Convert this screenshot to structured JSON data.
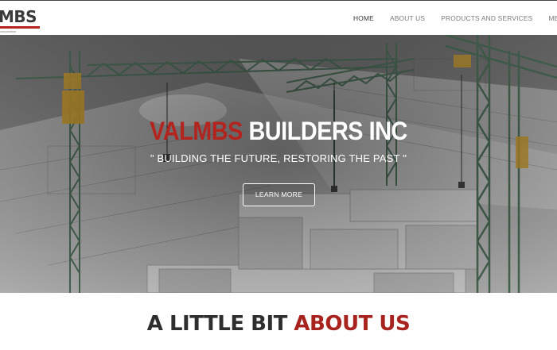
{
  "header": {
    "logo_text": "MBS",
    "logo_sub": "corporation"
  },
  "nav": {
    "items": [
      {
        "label": "HOME",
        "active": true
      },
      {
        "label": "ABOUT US",
        "active": false
      },
      {
        "label": "PRODUCTS AND SERVICES",
        "active": false
      },
      {
        "label": "MEET TH",
        "active": false
      }
    ]
  },
  "hero": {
    "title_red": "VALMBS",
    "title_white": " BUILDERS INC",
    "tagline": "\" BUILDING THE FUTURE, RESTORING THE PAST \"",
    "button_label": "LEARN MORE"
  },
  "about": {
    "heading_dark": "A LITTLE BIT ",
    "heading_red": "ABOUT US"
  },
  "colors": {
    "brand_red": "#b3241f",
    "crane_green": "#4d6e5a",
    "crane_yellow": "#c89a2e"
  }
}
